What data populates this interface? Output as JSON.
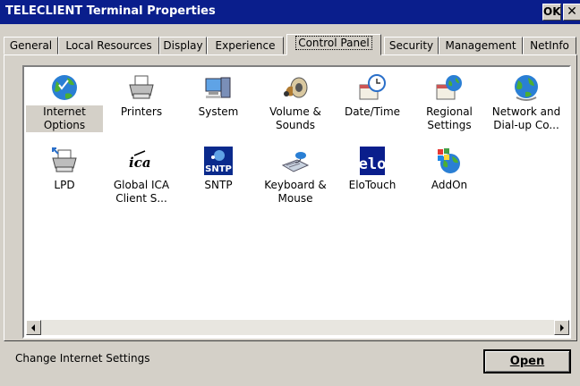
{
  "window": {
    "title": "TELECLIENT Terminal Properties",
    "ok_label": "OK",
    "close_label": "✕"
  },
  "tabs": [
    {
      "label": "General"
    },
    {
      "label": "Local Resources"
    },
    {
      "label": "Display"
    },
    {
      "label": "Experience"
    },
    {
      "label": "Control Panel",
      "active": true
    },
    {
      "label": "Security"
    },
    {
      "label": "Management"
    },
    {
      "label": "NetInfo"
    }
  ],
  "items": [
    {
      "label": "Internet Options",
      "icon": "internet-options-icon",
      "selected": true
    },
    {
      "label": "Printers",
      "icon": "printers-icon"
    },
    {
      "label": "System",
      "icon": "system-icon"
    },
    {
      "label": "Volume & Sounds",
      "icon": "volume-sounds-icon"
    },
    {
      "label": "Date/Time",
      "icon": "date-time-icon"
    },
    {
      "label": "Regional Settings",
      "icon": "regional-settings-icon"
    },
    {
      "label": "Network and Dial-up Co...",
      "icon": "network-dialup-icon"
    },
    {
      "label": "LPD",
      "icon": "lpd-icon"
    },
    {
      "label": "Global ICA Client S...",
      "icon": "ica-icon",
      "icon_text": "ica"
    },
    {
      "label": "SNTP",
      "icon": "sntp-icon",
      "icon_text": "SNTP"
    },
    {
      "label": "Keyboard & Mouse",
      "icon": "keyboard-mouse-icon"
    },
    {
      "label": "EloTouch",
      "icon": "elotouch-icon",
      "icon_text": "elo"
    },
    {
      "label": "AddOn",
      "icon": "addon-icon"
    }
  ],
  "status_text": "Change Internet Settings",
  "open_button": "Open"
}
